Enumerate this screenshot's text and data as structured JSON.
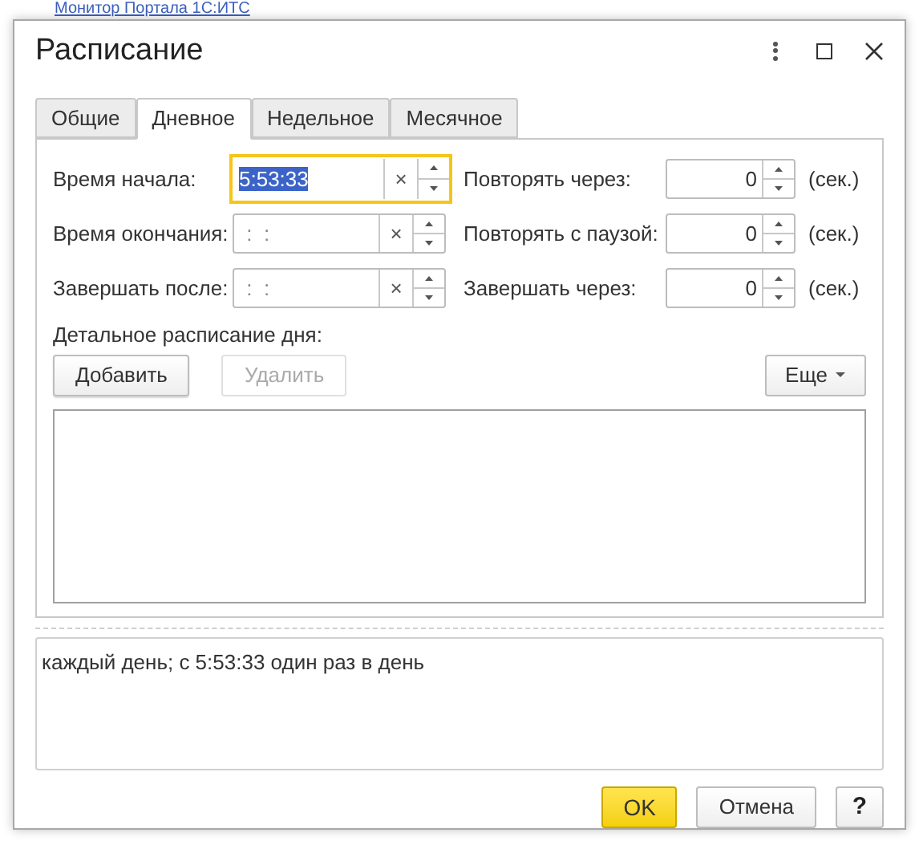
{
  "background_link": "Монитор Портала 1С:ИТС",
  "window": {
    "title": "Расписание"
  },
  "tabs": [
    {
      "label": "Общие",
      "selected": false
    },
    {
      "label": "Дневное",
      "selected": true
    },
    {
      "label": "Недельное",
      "selected": false
    },
    {
      "label": "Месячное",
      "selected": false
    }
  ],
  "time_fields": [
    {
      "label": "Время начала:",
      "value": "5:53:33",
      "focused": true,
      "clear": "×"
    },
    {
      "label": "Время окончания:",
      "placeholder": " :  : ",
      "focused": false,
      "clear": "×"
    },
    {
      "label": "Завершать после:",
      "placeholder": " :  : ",
      "focused": false,
      "clear": "×"
    }
  ],
  "number_fields": [
    {
      "label": "Повторять через:",
      "value": "0",
      "unit": "(сек.)"
    },
    {
      "label": "Повторять с паузой:",
      "value": "0",
      "unit": "(сек.)"
    },
    {
      "label": "Завершать через:",
      "value": "0",
      "unit": "(сек.)"
    }
  ],
  "detail": {
    "label": "Детальное расписание дня:",
    "buttons": [
      {
        "label": "Добавить",
        "disabled": false
      },
      {
        "label": "Удалить",
        "disabled": true
      }
    ],
    "more": "Еще"
  },
  "summary": "каждый день; с 5:53:33 один раз в день",
  "footer": [
    {
      "label": "OK",
      "kind": "primary"
    },
    {
      "label": "Отмена",
      "kind": "normal"
    },
    {
      "label": "?",
      "kind": "help"
    }
  ]
}
